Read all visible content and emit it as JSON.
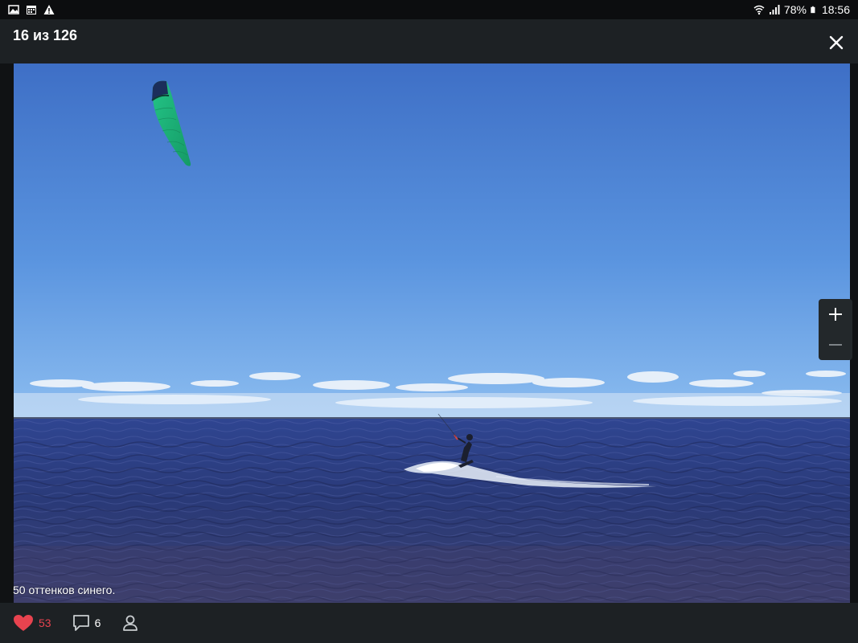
{
  "status_bar": {
    "left_icons": [
      "image-icon",
      "calendar-icon",
      "warning-icon"
    ],
    "right_icons": [
      "wifi-icon",
      "signal-icon",
      "battery-icon"
    ],
    "battery": "78%",
    "time": "18:56"
  },
  "viewer": {
    "counter": "16 из 126",
    "caption": "50 оттенков синего."
  },
  "actions": {
    "likes": "53",
    "comments": "6"
  },
  "colors": {
    "like": "#e8434f",
    "header_bg": "#1d2124",
    "sky_top": "#3f73c9",
    "sea": "#2a3a78",
    "kite": "#1fb07a"
  }
}
